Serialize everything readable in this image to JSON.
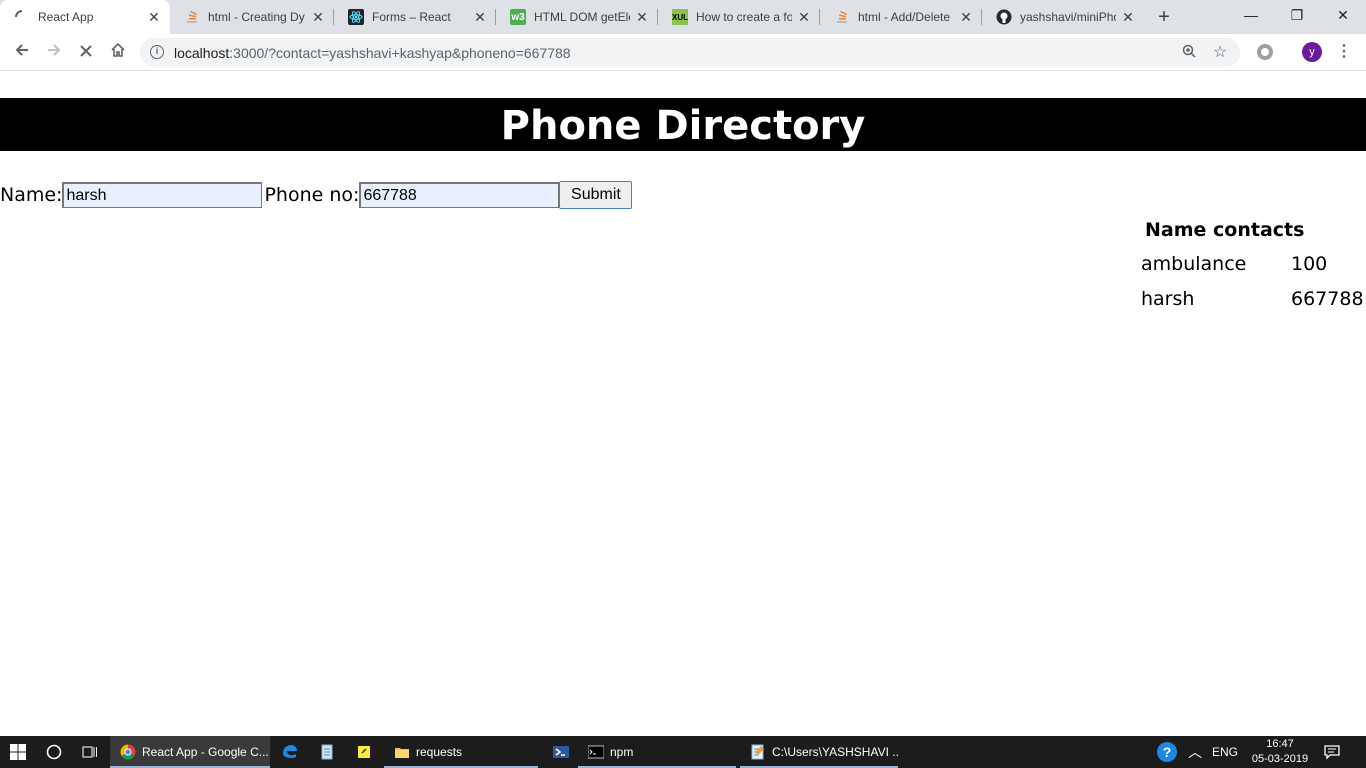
{
  "browser": {
    "tabs": [
      {
        "title": "React App",
        "icon": "loading-spinner-icon",
        "active": true
      },
      {
        "title": "html - Creating Dy",
        "icon": "stackoverflow-icon",
        "active": false
      },
      {
        "title": "Forms – React",
        "icon": "react-icon",
        "active": false
      },
      {
        "title": "HTML DOM getEle",
        "icon": "w3schools-icon",
        "active": false
      },
      {
        "title": "How to create a fo",
        "icon": "xul-icon",
        "active": false
      },
      {
        "title": "html - Add/Delete",
        "icon": "stackoverflow-icon",
        "active": false
      },
      {
        "title": "yashshavi/miniPho",
        "icon": "github-icon",
        "active": false
      }
    ],
    "url_host": "localhost",
    "url_rest": ":3000/?contact=yashshavi+kashyap&phoneno=667788",
    "profile_initial": "y"
  },
  "app": {
    "title": "Phone Directory",
    "form": {
      "name_label": "Name:",
      "name_value": "harsh",
      "phone_label": "Phone no:",
      "phone_value": "667788",
      "submit_label": "Submit"
    },
    "contacts": {
      "header": "Name contacts",
      "rows": [
        {
          "name": "ambulance",
          "phone": "100"
        },
        {
          "name": "harsh",
          "phone": "667788"
        }
      ]
    }
  },
  "taskbar": {
    "apps": [
      {
        "label": "React App - Google C...",
        "icon": "chrome-icon",
        "active": true
      },
      {
        "label": "requests",
        "icon": "folder-icon",
        "active": false
      },
      {
        "label": "npm",
        "icon": "cmd-icon",
        "active": false
      },
      {
        "label": "C:\\Users\\YASHSHAVI ...",
        "icon": "notepad-icon",
        "active": false
      }
    ],
    "language": "ENG",
    "time": "16:47",
    "date": "05-03-2019"
  }
}
